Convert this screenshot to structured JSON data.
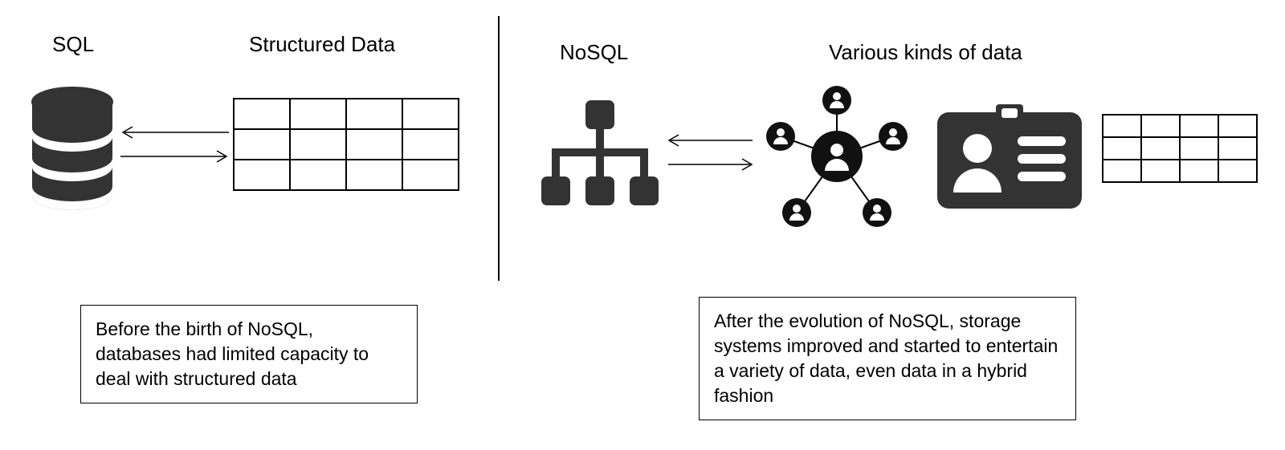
{
  "left": {
    "sql_label": "SQL",
    "structured_label": "Structured Data",
    "caption": "Before the birth of NoSQL, databases had limited capacity to deal with structured data"
  },
  "right": {
    "nosql_label": "NoSQL",
    "various_label": "Various kinds of data",
    "caption": "After the evolution of NoSQL, storage systems improved and started to entertain a variety of data, even data in a hybrid fashion"
  }
}
